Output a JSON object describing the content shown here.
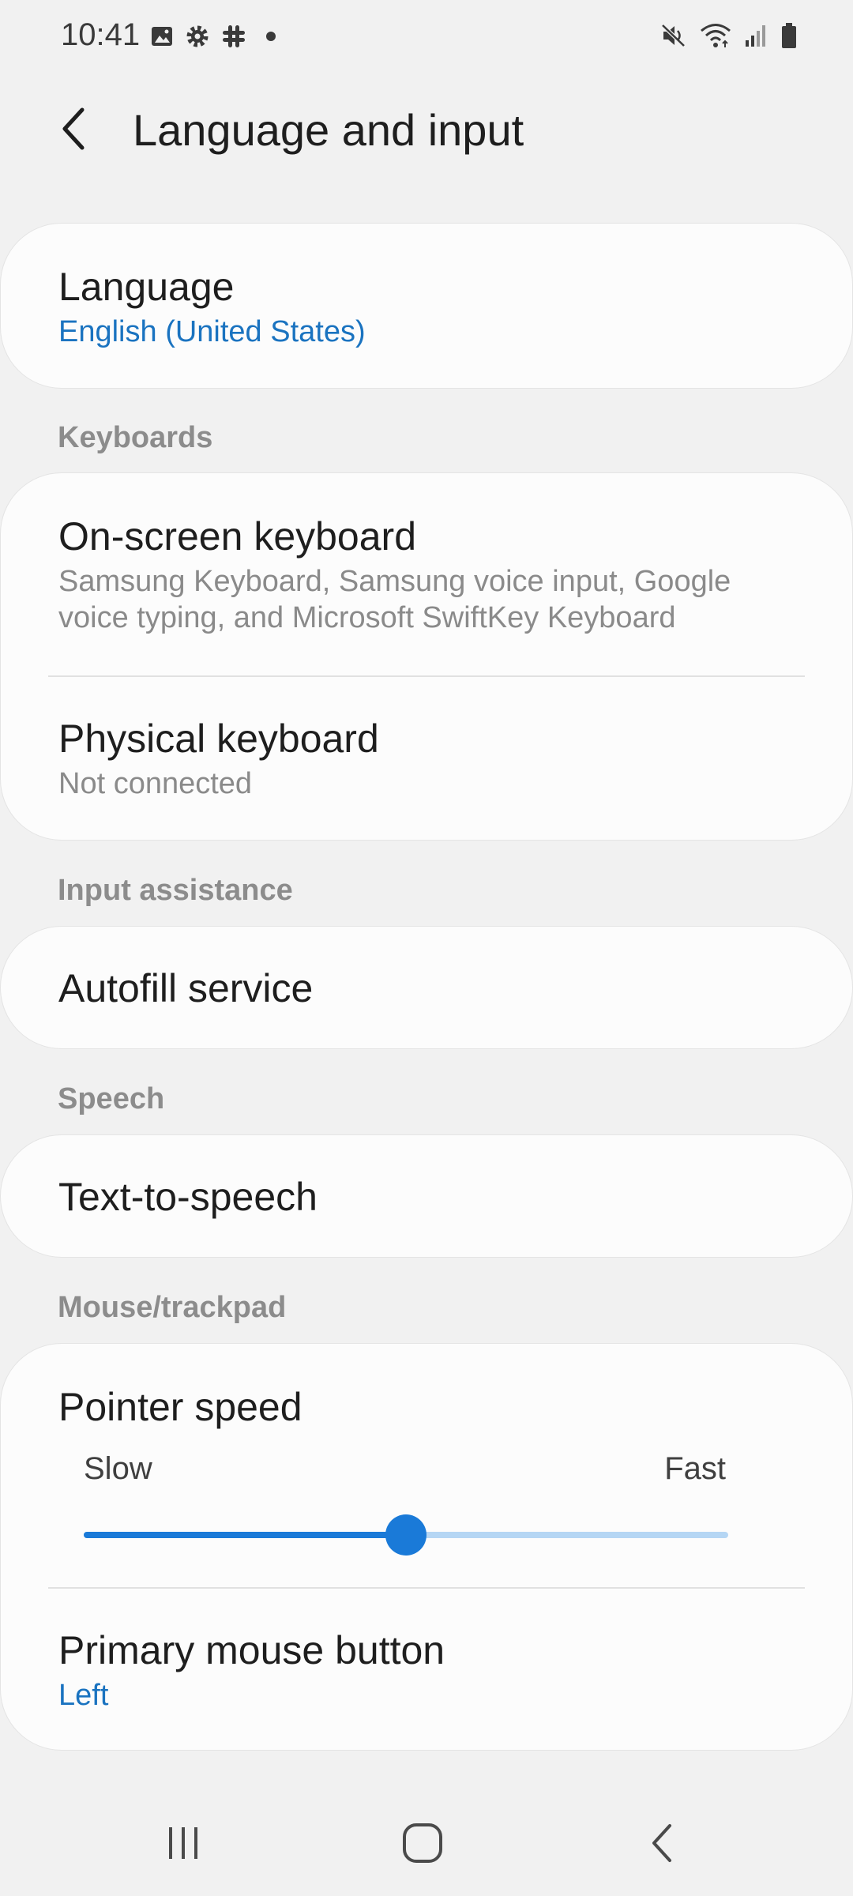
{
  "status_bar": {
    "time": "10:41",
    "left_icons": [
      "image-icon",
      "gear-icon",
      "slack-icon",
      "dot-icon"
    ],
    "right_icons": [
      "mute-icon",
      "wifi-icon",
      "signal-icon",
      "battery-icon"
    ]
  },
  "header": {
    "title": "Language and input",
    "back_icon": "chevron-left-icon"
  },
  "language": {
    "title": "Language",
    "value": "English (United States)"
  },
  "sections": {
    "keyboards": "Keyboards",
    "input_assistance": "Input assistance",
    "speech": "Speech",
    "mouse": "Mouse/trackpad"
  },
  "keyboards": {
    "onscreen_title": "On-screen keyboard",
    "onscreen_sub_line1": "Samsung Keyboard, Samsung voice input, Google",
    "onscreen_sub_line2": "voice typing, and Microsoft SwiftKey Keyboard",
    "physical_title": "Physical keyboard",
    "physical_sub": "Not connected"
  },
  "input_assistance": {
    "autofill_title": "Autofill service"
  },
  "speech": {
    "tts_title": "Text-to-speech"
  },
  "mouse": {
    "pointer_title": "Pointer speed",
    "slow_label": "Slow",
    "fast_label": "Fast",
    "pointer_level": 0.5,
    "primary_title": "Primary mouse button",
    "primary_value": "Left"
  },
  "nav": {
    "recents_icon": "recents-icon",
    "home_icon": "home-icon",
    "back_icon": "back-icon"
  },
  "colors": {
    "accent": "#1a7ad8",
    "link": "#1a73c0",
    "background": "#f1f1f1",
    "card": "#fcfcfc"
  }
}
